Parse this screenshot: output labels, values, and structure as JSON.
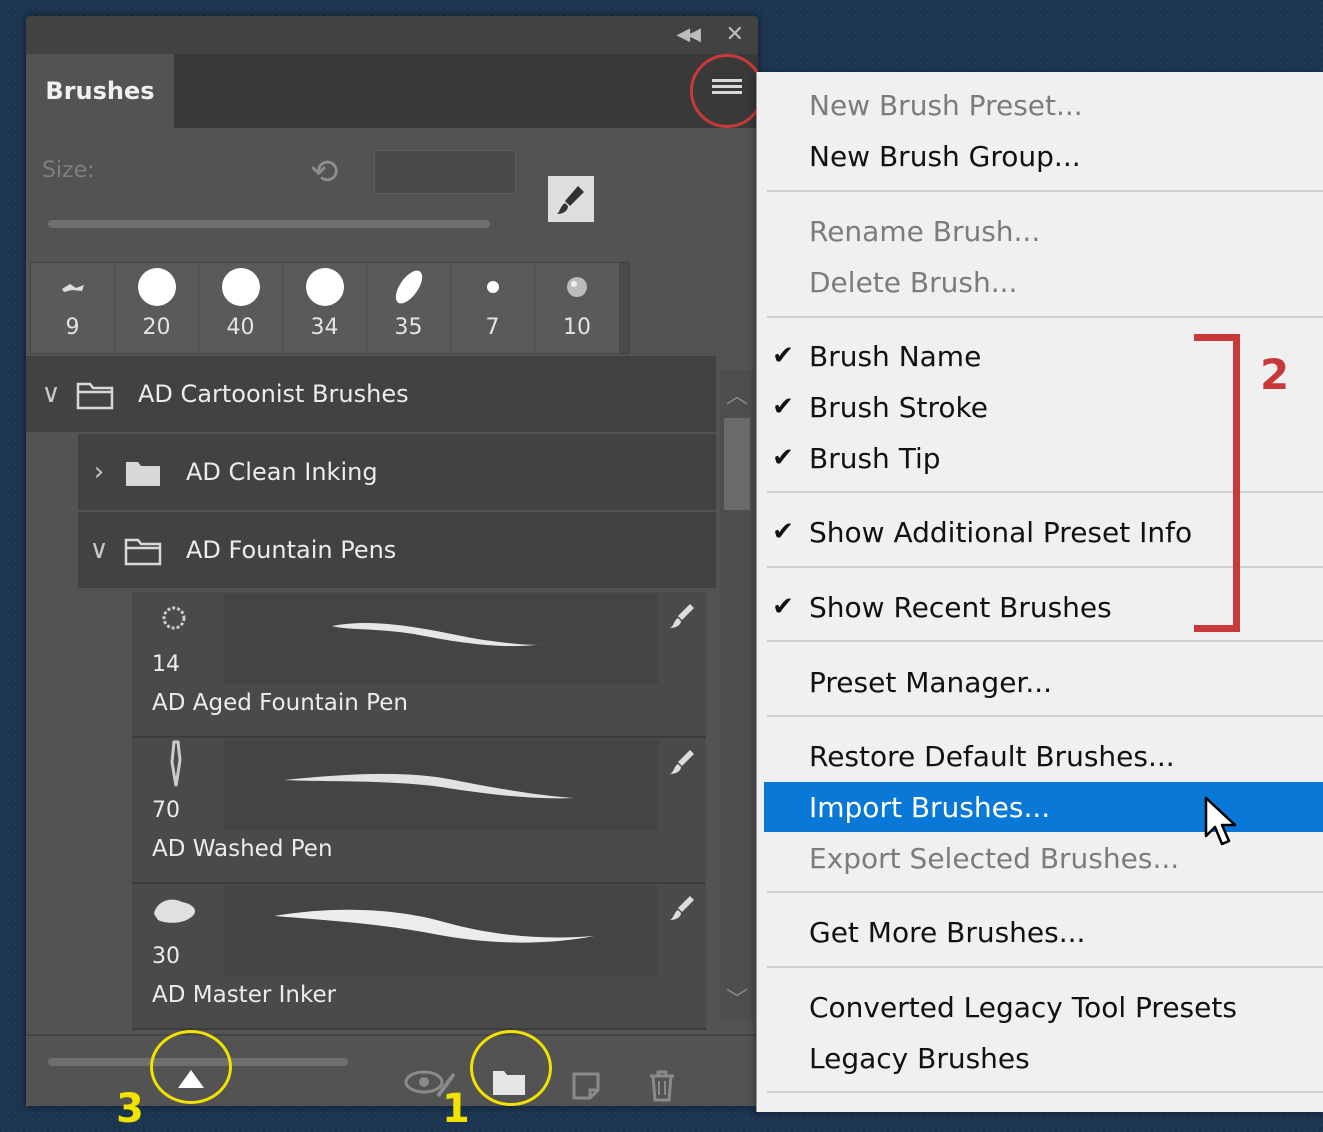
{
  "panel": {
    "tab_label": "Brushes",
    "size_label": "Size:",
    "size_value": "",
    "recent_brushes": [
      "9",
      "20",
      "40",
      "34",
      "35",
      "7",
      "10"
    ],
    "groups": {
      "cartoonist": "AD Cartoonist Brushes",
      "clean_inking": "AD Clean Inking",
      "fountain_pens": "AD Fountain Pens"
    },
    "brushes": [
      {
        "size": "14",
        "name": "AD Aged Fountain Pen"
      },
      {
        "size": "70",
        "name": "AD Washed Pen"
      },
      {
        "size": "30",
        "name": "AD Master Inker"
      }
    ]
  },
  "annotations": {
    "one": "1",
    "two": "2",
    "three": "3"
  },
  "menu": {
    "new_brush_preset": "New Brush Preset...",
    "new_brush_group": "New Brush Group...",
    "rename_brush": "Rename Brush...",
    "delete_brush": "Delete Brush...",
    "brush_name": "Brush Name",
    "brush_stroke": "Brush Stroke",
    "brush_tip": "Brush Tip",
    "show_additional_preset_info": "Show Additional Preset Info",
    "show_recent_brushes": "Show Recent Brushes",
    "preset_manager": "Preset Manager...",
    "restore_default_brushes": "Restore Default Brushes...",
    "import_brushes": "Import Brushes...",
    "export_selected_brushes": "Export Selected Brushes...",
    "get_more_brushes": "Get More Brushes...",
    "converted_legacy_tool_presets": "Converted Legacy Tool Presets",
    "legacy_brushes": "Legacy Brushes",
    "check_glyph": "✔"
  },
  "colors": {
    "highlight": "#0a78d7",
    "annotation_red": "#c83a3a",
    "annotation_yellow": "#f2e200"
  }
}
